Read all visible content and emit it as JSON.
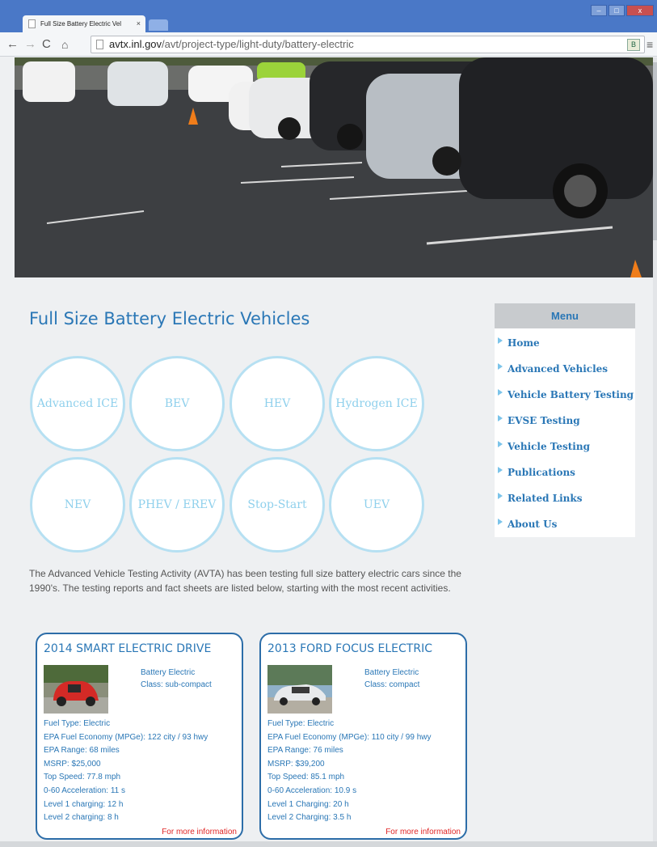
{
  "browser": {
    "tab_title": "Full Size Battery Electric Vel",
    "tab_close": "×",
    "url_domain": "avtx.inl.gov",
    "url_path": "/avt/project-type/light-duty/battery-electric",
    "window_controls": [
      "minimize-icon",
      "maximize-icon",
      "close-icon"
    ]
  },
  "page": {
    "title": "Full Size Battery Electric Vehicles",
    "categories": [
      "Advanced ICE",
      "BEV",
      "HEV",
      "Hydrogen ICE",
      "NEV",
      "PHEV / EREV",
      "Stop-Start",
      "UEV"
    ],
    "intro": "The Advanced Vehicle Testing Activity (AVTA) has been testing full size battery electric cars since the 1990's. The testing reports and fact sheets are listed below, starting with the most recent activities.",
    "cards": [
      {
        "title": "2014 SMART ELECTRIC DRIVE",
        "type": "Battery Electric",
        "class": "Class: sub-compact",
        "car_color": "#d42a26",
        "specs": [
          "Fuel Type:  Electric",
          "EPA Fuel Economy (MPGe): 122 city / 93 hwy",
          "EPA Range: 68 miles",
          "MSRP:  $25,000",
          "Top Speed:  77.8 mph",
          "0-60 Acceleration:  11 s",
          "Level 1 charging:  12 h",
          "Level 2 charging:  8 h"
        ],
        "more": "For more information"
      },
      {
        "title": "2013 FORD FOCUS ELECTRIC",
        "type": "Battery Electric",
        "class": "Class: compact",
        "car_color": "#e8eaec",
        "specs": [
          "Fuel Type:  Electric",
          "EPA Fuel Economy (MPGe): 110  city / 99 hwy",
          "EPA Range:  76 miles",
          "MSRP:  $39,200",
          "Top Speed:  85.1 mph",
          "0-60 Acceleration:  10.9 s",
          "Level 1 Charging:  20 h",
          "Level 2 Charging:  3.5 h"
        ],
        "more": "For more information"
      }
    ]
  },
  "menu": {
    "heading": "Menu",
    "items": [
      "Home",
      "Advanced Vehicles",
      "Vehicle Battery Testing",
      "EVSE Testing",
      "Vehicle Testing",
      "Publications",
      "Related Links",
      "About Us"
    ]
  },
  "colors": {
    "accent": "#2a77b6",
    "circle_border": "#b6e0f2",
    "link_red": "#e02626",
    "chrome_blue": "#4a78c7"
  }
}
